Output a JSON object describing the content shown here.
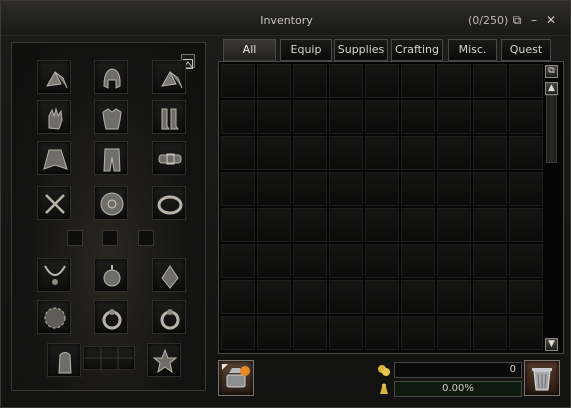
{
  "window": {
    "title": "Inventory",
    "count": "(0/250)"
  },
  "titlebar_buttons": [
    {
      "name": "restore-icon",
      "glyph": "⧉"
    },
    {
      "name": "minimize-icon",
      "glyph": "–"
    },
    {
      "name": "close-icon",
      "glyph": "✕"
    }
  ],
  "tabs": [
    {
      "id": "all",
      "label": "All",
      "active": true
    },
    {
      "id": "equip",
      "label": "Equip",
      "active": false
    },
    {
      "id": "supplies",
      "label": "Supplies",
      "active": false
    },
    {
      "id": "crafting",
      "label": "Crafting",
      "active": false
    },
    {
      "id": "misc",
      "label": "Misc.",
      "active": false
    },
    {
      "id": "quest",
      "label": "Quest",
      "active": false
    }
  ],
  "grid": {
    "columns": 9,
    "rows": 8
  },
  "equipment_slots": [
    {
      "name": "earring-left-slot",
      "icon": "earring-icon"
    },
    {
      "name": "helmet-slot",
      "icon": "helmet-icon"
    },
    {
      "name": "earring-right-slot",
      "icon": "earring-icon"
    },
    {
      "name": "gloves-slot",
      "icon": "gloves-icon"
    },
    {
      "name": "armor-slot",
      "icon": "chest-armor-icon"
    },
    {
      "name": "boots-slot",
      "icon": "boots-icon"
    },
    {
      "name": "cloak-slot",
      "icon": "cloak-icon"
    },
    {
      "name": "pants-slot",
      "icon": "pants-icon"
    },
    {
      "name": "belt-slot",
      "icon": "belt-icon"
    },
    {
      "name": "weapon-slot",
      "icon": "crossed-swords-icon"
    },
    {
      "name": "shield-slot",
      "icon": "shield-icon"
    },
    {
      "name": "bracelet-slot",
      "icon": "bracelet-icon"
    },
    {
      "name": "necklace-slot",
      "icon": "necklace-icon"
    },
    {
      "name": "amulet-slot",
      "icon": "amulet-icon"
    },
    {
      "name": "pendant-slot",
      "icon": "pendant-icon"
    },
    {
      "name": "brooch-slot",
      "icon": "brooch-icon"
    },
    {
      "name": "ring-left-slot",
      "icon": "ring-icon"
    },
    {
      "name": "ring-right-slot",
      "icon": "ring-icon"
    },
    {
      "name": "thimble-slot",
      "icon": "thimble-icon"
    },
    {
      "name": "charm-slot",
      "icon": "charm-icon"
    }
  ],
  "currency": {
    "gold": "0",
    "weight": "0.00%",
    "weight_fraction": 0.0
  },
  "colors": {
    "accent": "#c9a54a",
    "weight_fill": "#3f7a2a"
  }
}
